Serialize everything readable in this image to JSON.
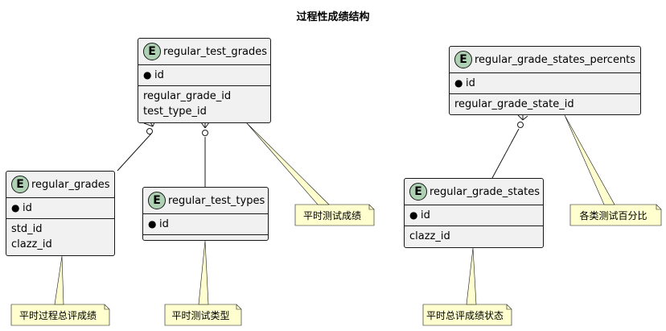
{
  "diagram": {
    "title": "过程性成绩结构"
  },
  "entities": {
    "regular_test_grades": {
      "badge": "E",
      "name": "regular_test_grades",
      "pk": "id",
      "fields": [
        "regular_grade_id",
        "test_type_id"
      ]
    },
    "regular_grades": {
      "badge": "E",
      "name": "regular_grades",
      "pk": "id",
      "fields": [
        "std_id",
        "clazz_id"
      ]
    },
    "regular_test_types": {
      "badge": "E",
      "name": "regular_test_types",
      "pk": "id",
      "fields": []
    },
    "regular_grade_states_percents": {
      "badge": "E",
      "name": "regular_grade_states_percents",
      "pk": "id",
      "fields": [
        "regular_grade_state_id"
      ]
    },
    "regular_grade_states": {
      "badge": "E",
      "name": "regular_grade_states",
      "pk": "id",
      "fields": [
        "clazz_id"
      ]
    }
  },
  "notes": {
    "regular_test_grades": "平时测试成绩",
    "regular_grades": "平时过程总评成绩",
    "regular_test_types": "平时测试类型",
    "regular_grade_states": "平时总评成绩状态",
    "regular_grade_states_percents": "各类测试百分比"
  },
  "colors": {
    "entity_fill": "#f1f1f1",
    "badge_fill": "#add1b2",
    "note_fill": "#fefece",
    "line": "#181818"
  }
}
